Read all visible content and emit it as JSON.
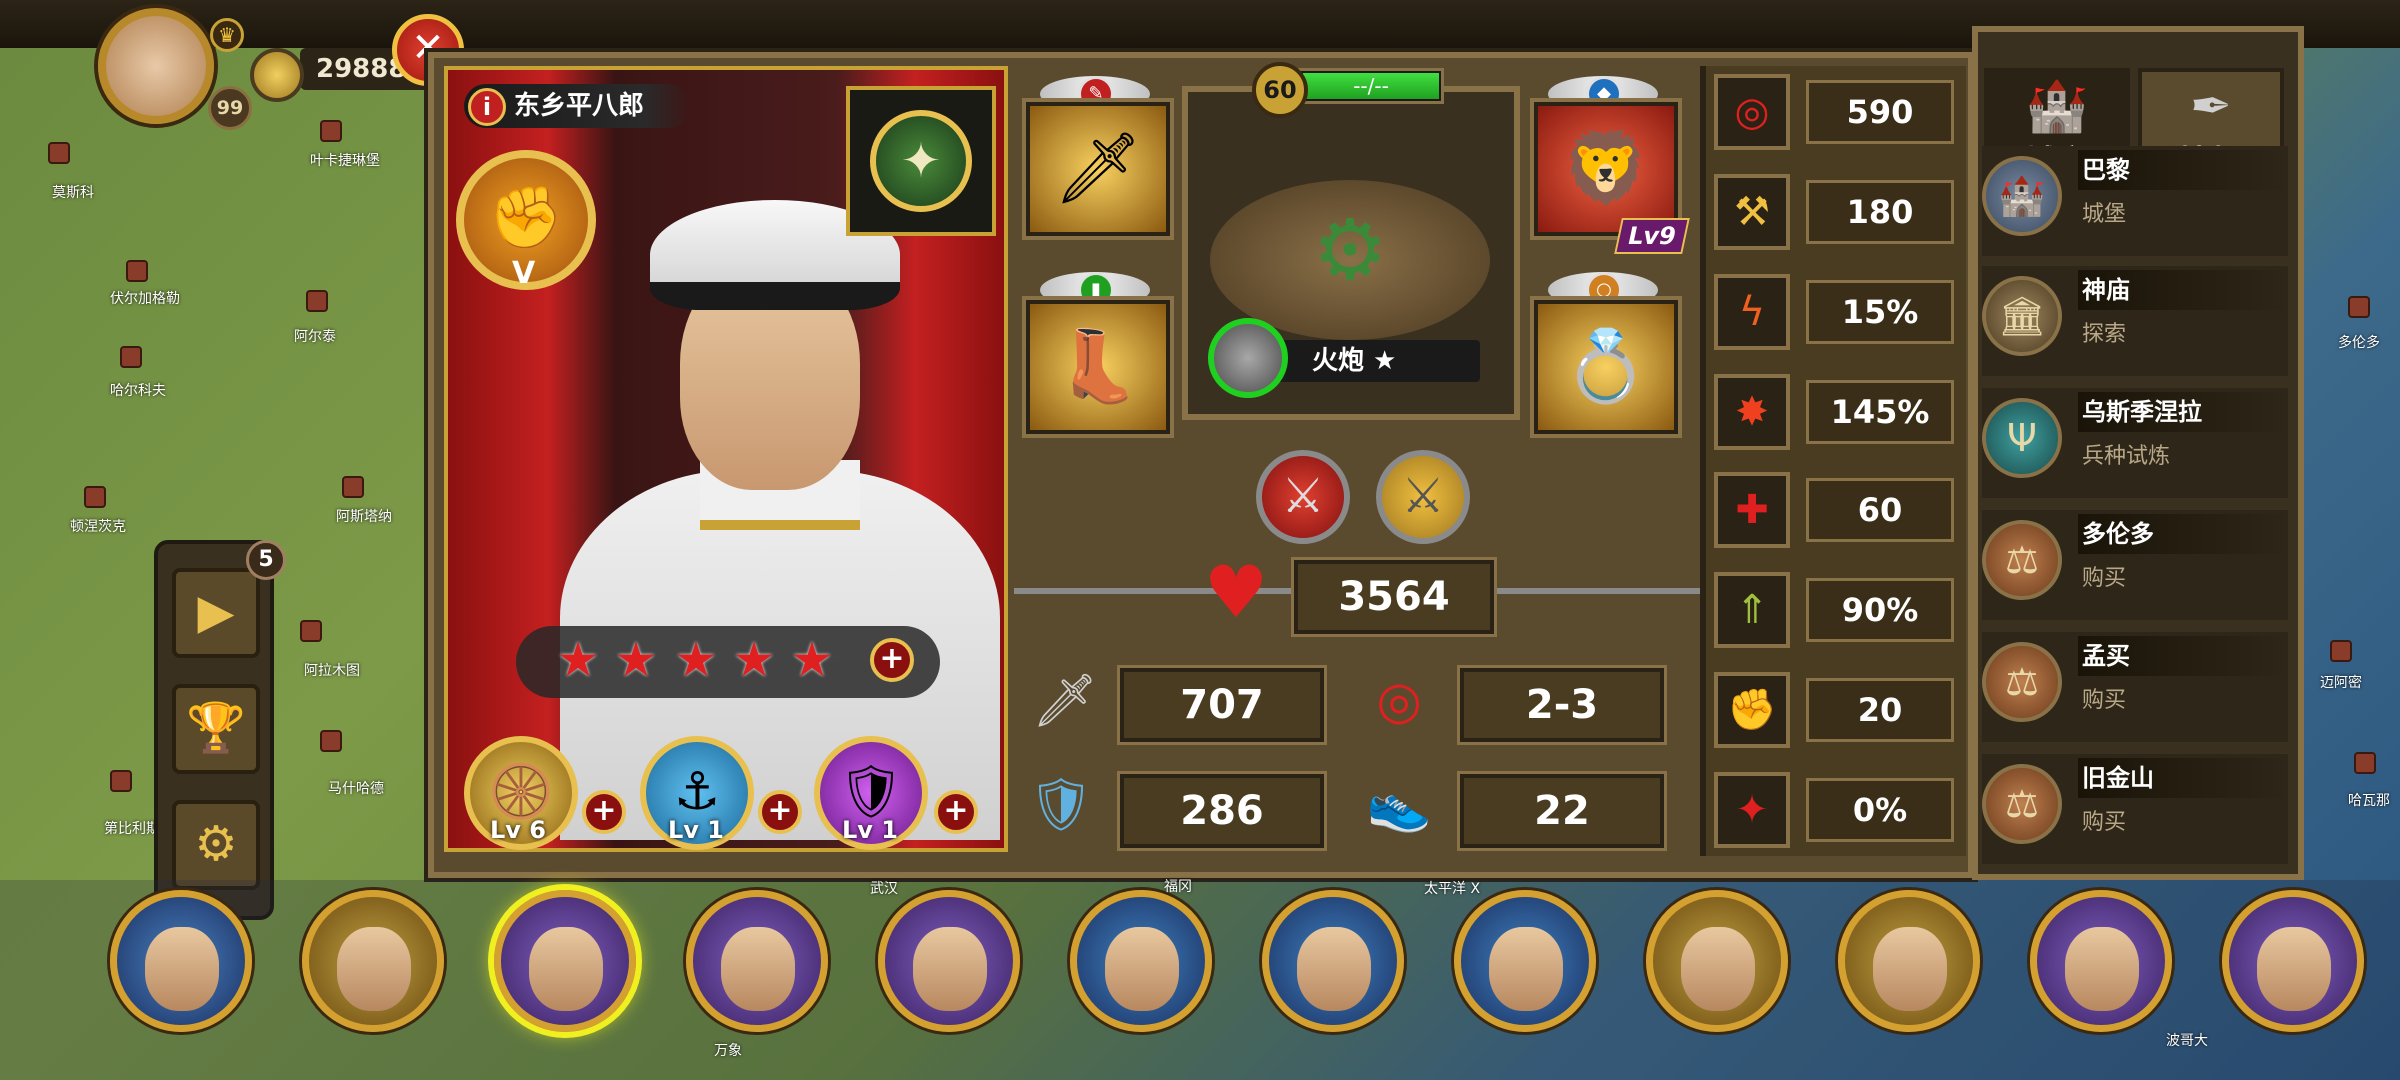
{
  "top": {
    "gold": "29888",
    "player_level": "99"
  },
  "hero": {
    "name": "东乡平八郎",
    "rank": "V",
    "stars": 5,
    "skills": [
      {
        "name": "cannon-skill",
        "level": "Lv 6",
        "color": "#d4a020"
      },
      {
        "name": "anchor-skill",
        "level": "Lv 1",
        "color": "#30a0d0"
      },
      {
        "name": "shield-skill",
        "level": "Lv 1",
        "color": "#a030c0"
      }
    ]
  },
  "unit": {
    "level": "60",
    "bar_text": "--/--",
    "bar_fill": 1.0,
    "name": "火炮 ★",
    "armor_level": "Lv9"
  },
  "stats": {
    "hp": "3564",
    "attack": "707",
    "range": "2-3",
    "defense": "286",
    "move": "22"
  },
  "right_stats": [
    {
      "icon": "target-icon",
      "value": "590"
    },
    {
      "icon": "hammer-icon",
      "value": "180"
    },
    {
      "icon": "lightning-icon",
      "value": "15%"
    },
    {
      "icon": "sword-burst-icon",
      "value": "145%"
    },
    {
      "icon": "medic-cross-icon",
      "value": "60"
    },
    {
      "icon": "rank-up-icon",
      "value": "90%"
    },
    {
      "icon": "fist-icon",
      "value": "20"
    },
    {
      "icon": "figure-icon",
      "value": "0%"
    }
  ],
  "city_panel": {
    "tabs": [
      "城市",
      "情报"
    ],
    "items": [
      {
        "name": "巴黎",
        "sub": "城堡",
        "icon": "castle-icon"
      },
      {
        "name": "神庙",
        "sub": "探索",
        "icon": "temple-icon"
      },
      {
        "name": "乌斯季涅拉",
        "sub": "兵种试炼",
        "icon": "trident-icon"
      },
      {
        "name": "多伦多",
        "sub": "购买",
        "icon": "scales-icon"
      },
      {
        "name": "孟买",
        "sub": "购买",
        "icon": "scales-icon"
      },
      {
        "name": "旧金山",
        "sub": "购买",
        "icon": "scales-icon"
      }
    ]
  },
  "side_badge": "5",
  "map_labels": [
    "叶卡捷琳堡",
    "莫斯科",
    "伏尔加格勒",
    "阿尔泰",
    "哈尔科夫",
    "顿涅茨克",
    "阿斯塔纳",
    "阿拉木图",
    "马什哈德",
    "第比利斯",
    "武汉",
    "福冈",
    "太平洋 X",
    "万象",
    "迈阿密",
    "哈瓦那",
    "波哥大",
    "多伦多",
    "旧金山"
  ]
}
